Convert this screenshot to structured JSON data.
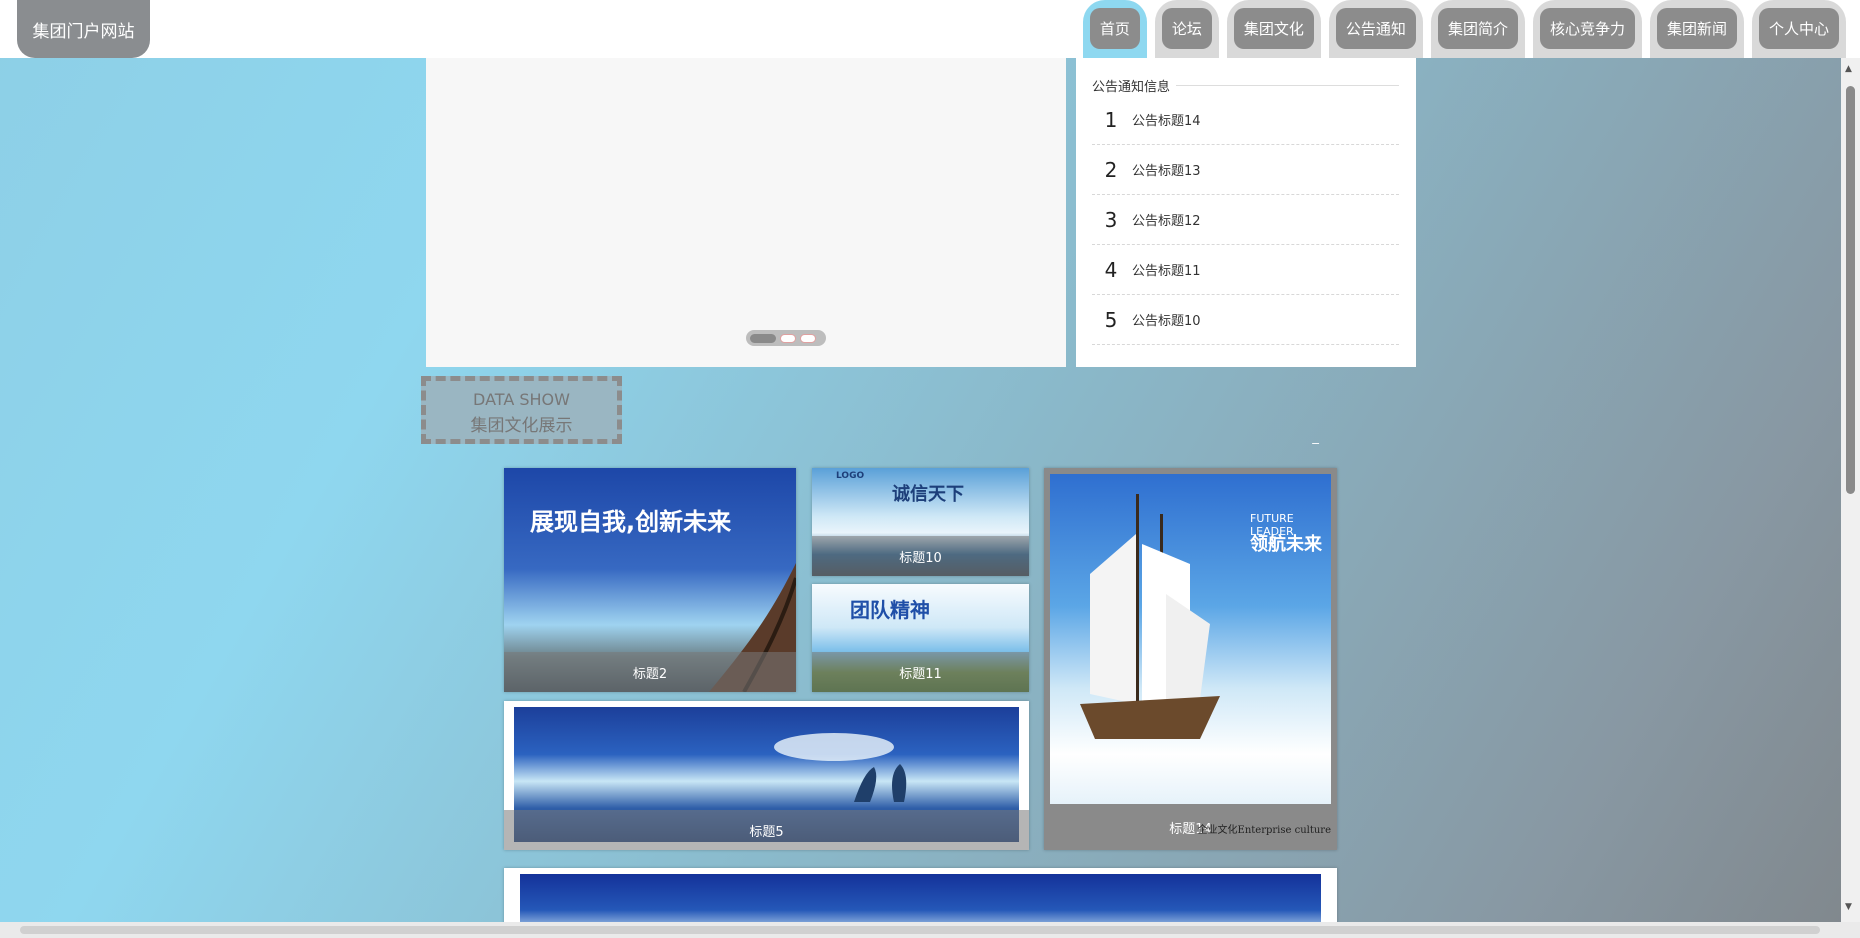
{
  "site": {
    "brand": "集团门户网站"
  },
  "nav": [
    {
      "label": "首页",
      "active": true
    },
    {
      "label": "论坛"
    },
    {
      "label": "集团文化"
    },
    {
      "label": "公告通知"
    },
    {
      "label": "集团简介"
    },
    {
      "label": "核心竞争力"
    },
    {
      "label": "集团新闻"
    },
    {
      "label": "个人中心"
    }
  ],
  "carousel": {
    "slide_count": 3,
    "active_index": 0
  },
  "notice": {
    "heading": "公告通知信息",
    "items": [
      {
        "num": "1",
        "title": "公告标题14"
      },
      {
        "num": "2",
        "title": "公告标题13"
      },
      {
        "num": "3",
        "title": "公告标题12"
      },
      {
        "num": "4",
        "title": "公告标题11"
      },
      {
        "num": "5",
        "title": "公告标题10"
      }
    ]
  },
  "section": {
    "en": "DATA SHOW",
    "cn": "集团文化展示",
    "collapse_symbol": "−"
  },
  "tiles": [
    {
      "caption": "标题2",
      "headline": "展现自我,创新未来"
    },
    {
      "caption": "标题10",
      "headline": "诚信天下",
      "logo": "LOGO"
    },
    {
      "caption": "标题11",
      "headline": "团队精神"
    },
    {
      "caption": "标题5"
    },
    {
      "caption": "标题14",
      "headline_en": "FUTURE LEADER",
      "headline": "领航未来",
      "footnote": "企业文化Enterprise culture"
    }
  ],
  "colors": {
    "accent": "#8ed8f0",
    "nav_tab": "#8c8c8c",
    "brand_bg": "#8a8d90"
  }
}
